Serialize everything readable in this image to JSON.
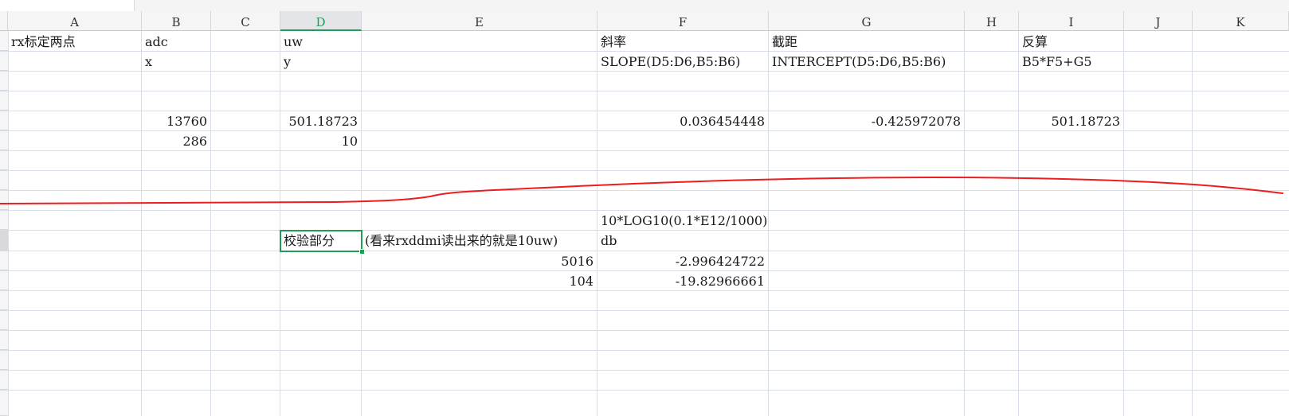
{
  "sheet": {
    "column_headers": [
      "A",
      "B",
      "C",
      "D",
      "E",
      "F",
      "G",
      "H",
      "I",
      "J",
      "K"
    ],
    "selected_column": "D",
    "selected_cell": "D11"
  },
  "cells": {
    "a1": "rx标定两点",
    "b1": "adc",
    "d1": "uw",
    "f1": "斜率",
    "g1": "截距",
    "i1": "反算",
    "b2": "x",
    "d2": "y",
    "f2": "SLOPE(D5:D6,B5:B6)",
    "g2": "INTERCEPT(D5:D6,B5:B6)",
    "i2": "B5*F5+G5",
    "b5": "13760",
    "d5": "501.18723",
    "f5": "0.036454448",
    "g5": "-0.425972078",
    "i5": "501.18723",
    "b6": "286",
    "d6": "10",
    "f10": "10*LOG10(0.1*E12/1000)",
    "d11": "校验部分",
    "e11": "(看来rxddmi读出来的就是10uw)",
    "f11": "db",
    "e12": "5016",
    "f12": "-2.996424722",
    "e13": "104",
    "f13": "-19.82966661"
  },
  "annotation": {
    "type": "freehand-line",
    "color": "#ee1c1c"
  }
}
